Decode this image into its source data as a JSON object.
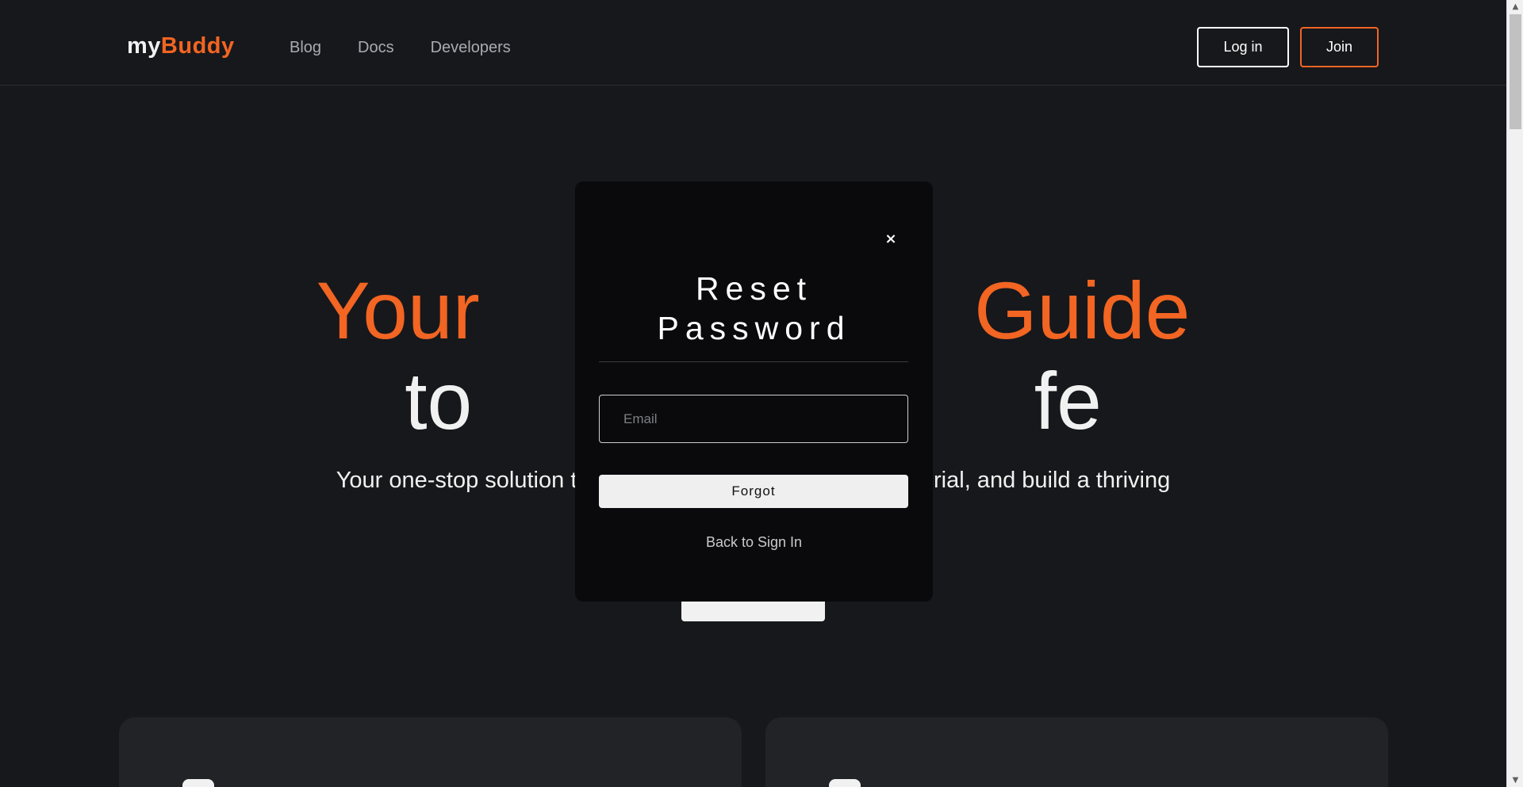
{
  "header": {
    "logo": {
      "part1": "my",
      "part2": "Buddy"
    },
    "nav": [
      {
        "label": "Blog"
      },
      {
        "label": "Docs"
      },
      {
        "label": "Developers"
      }
    ],
    "login_label": "Log in",
    "join_label": "Join"
  },
  "hero": {
    "line1": "Your                      Guide",
    "line2": "to                         fe",
    "subtitle": "Your one-stop solution to ace                                    e material, and build a thriving"
  },
  "modal": {
    "close_glyph": "×",
    "title_line1": "Reset",
    "title_line2": "Password",
    "email_placeholder": "Email",
    "email_value": "",
    "submit_label": "Forgot",
    "back_label": "Back to Sign In"
  },
  "scrollbar": {
    "up_glyph": "▲",
    "down_glyph": "▼"
  },
  "colors": {
    "background": "#17181c",
    "accent": "#f26522",
    "modal_bg": "#0a0a0c",
    "card_bg": "#222327"
  }
}
